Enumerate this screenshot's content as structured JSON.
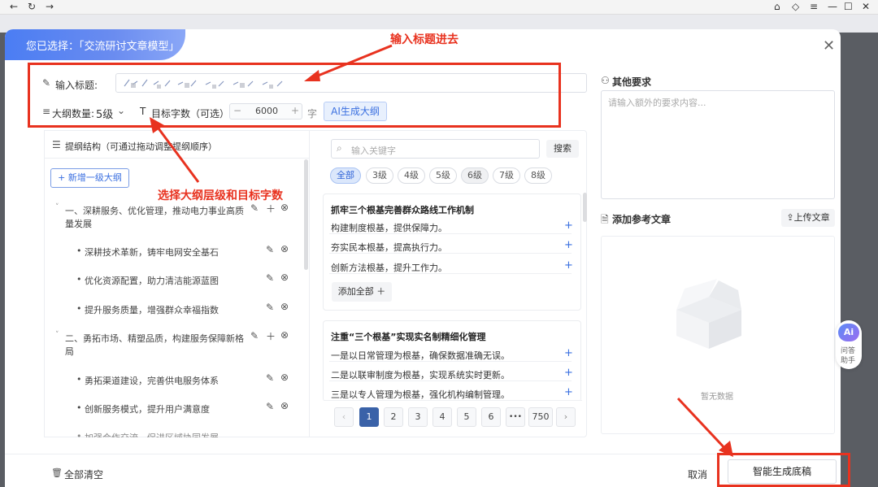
{
  "browser": {
    "back": "←",
    "refresh": "↻",
    "forward": "→"
  },
  "header": {
    "selection_text": "您已选择：「交流研讨文章模型」"
  },
  "form": {
    "title_label": "输入标题:",
    "outline_count_label": "大纲数量:",
    "outline_count_value": "5级",
    "word_target_label": "目标字数（可选）:",
    "word_target_value": "6000",
    "word_unit": "字",
    "ai_button": "AI生成大纲"
  },
  "annotations": {
    "input_title": "输入标题进去",
    "choose_level": "选择大纲层级和目标字数"
  },
  "outline": {
    "header": "提纲结构（可通过拖动调整提纲顺序）",
    "add_button": "+ 新增一级大纲",
    "items": [
      {
        "text": "一、深耕服务、优化管理，推动电力事业高质",
        "text2": "量发展"
      },
      {
        "text": "深耕技术革新，铸牢电网安全基石"
      },
      {
        "text": "优化资源配置，助力清洁能源蓝图"
      },
      {
        "text": "提升服务质量，增强群众幸福指数"
      },
      {
        "text": "二、勇拓市场、精塑品质，构建服务保障新格",
        "text2": "局"
      },
      {
        "text": "勇拓渠道建设，完善供电服务体系"
      },
      {
        "text": "创新服务模式，提升用户满意度"
      },
      {
        "text": "加强合作交流，促进区域协同发展"
      }
    ]
  },
  "library": {
    "search_placeholder": "输入关键字",
    "search_button": "搜索",
    "filters": [
      "全部",
      "3级",
      "4级",
      "5级",
      "6级",
      "7级",
      "8级"
    ],
    "cards": [
      {
        "title": "抓牢三个根基完善群众路线工作机制",
        "items": [
          "构建制度根基，提供保障力。",
          "夯实民本根基，提高执行力。",
          "创新方法根基，提升工作力。"
        ],
        "add_all": "添加全部 ＋"
      },
      {
        "title": "注重“三个根基”实现实名制精细化管理",
        "items": [
          "一是以日常管理为根基，确保数据准确无误。",
          "二是以联审制度为根基，实现系统实时更新。",
          "三是以专人管理为根基，强化机构编制管理。"
        ]
      }
    ],
    "pages": [
      "‹",
      "1",
      "2",
      "3",
      "4",
      "5",
      "6",
      "•••",
      "750",
      "›"
    ]
  },
  "right": {
    "other_req_title": "其他要求",
    "other_req_placeholder": "请输入额外的要求内容...",
    "ref_title": "添加参考文章",
    "upload_button": "上传文章",
    "empty_text": "暂无数据",
    "ai_helper_logo": "Ai",
    "ai_helper_label1": "问答",
    "ai_helper_label2": "助手"
  },
  "footer": {
    "clear_all": "全部清空",
    "cancel": "取消",
    "generate": "智能生成底稿"
  }
}
